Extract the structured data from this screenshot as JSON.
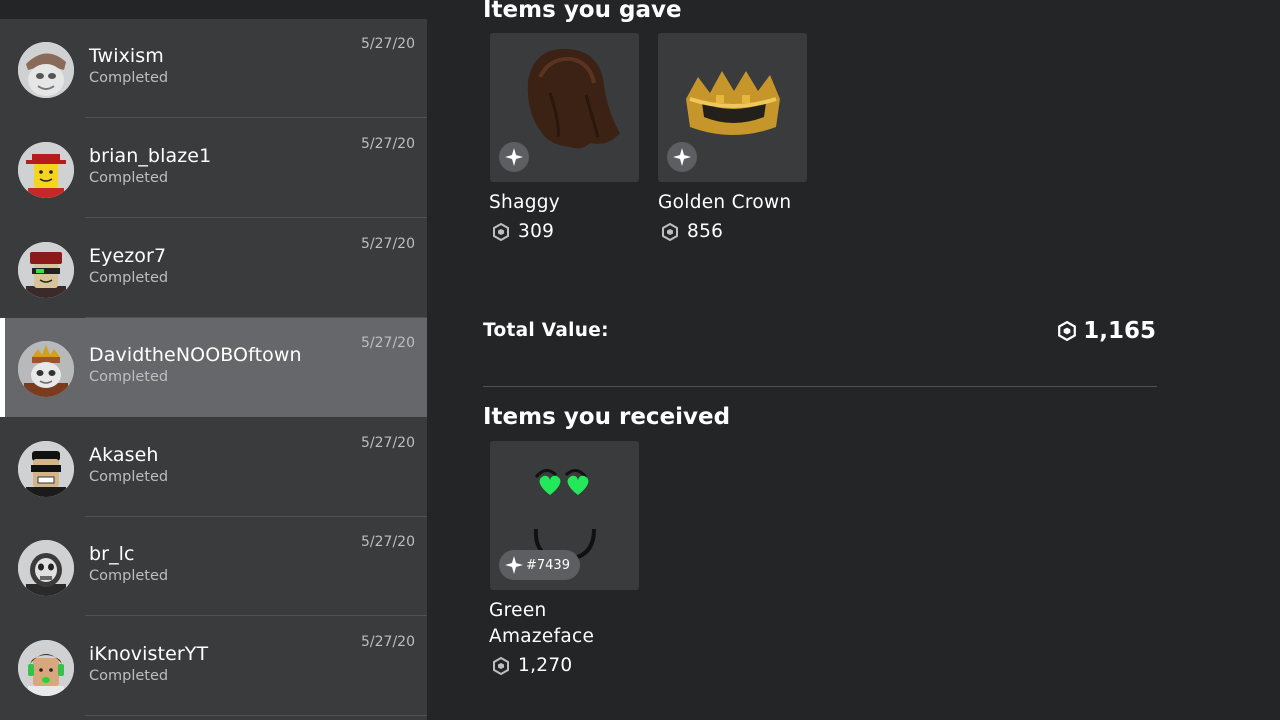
{
  "trades": [
    {
      "username": "Twixism",
      "status": "Completed",
      "date": "5/27/20",
      "selected": false
    },
    {
      "username": "brian_blaze1",
      "status": "Completed",
      "date": "5/27/20",
      "selected": false
    },
    {
      "username": "Eyezor7",
      "status": "Completed",
      "date": "5/27/20",
      "selected": false
    },
    {
      "username": "DavidtheNOOBOftown",
      "status": "Completed",
      "date": "5/27/20",
      "selected": true
    },
    {
      "username": "Akaseh",
      "status": "Completed",
      "date": "5/27/20",
      "selected": false
    },
    {
      "username": "br_lc",
      "status": "Completed",
      "date": "5/27/20",
      "selected": false
    },
    {
      "username": "iKnovisterYT",
      "status": "Completed",
      "date": "5/27/20",
      "selected": false
    }
  ],
  "gave": {
    "title": "Items you gave",
    "items": [
      {
        "name": "Shaggy",
        "price": "309",
        "icon": "shaggy-hair"
      },
      {
        "name": "Golden Crown",
        "price": "856",
        "icon": "golden-crown"
      }
    ]
  },
  "total": {
    "label": "Total Value:",
    "value": "1,165"
  },
  "received": {
    "title": "Items you received",
    "items": [
      {
        "name_line1": "Green",
        "name_line2": "Amazeface",
        "price": "1,270",
        "serial": "#7439",
        "icon": "green-amazeface"
      }
    ]
  },
  "colors": {
    "background": "#232527",
    "panel": "#393b3d",
    "selected_row": "#65676a",
    "text_secondary": "#bdbebe"
  }
}
